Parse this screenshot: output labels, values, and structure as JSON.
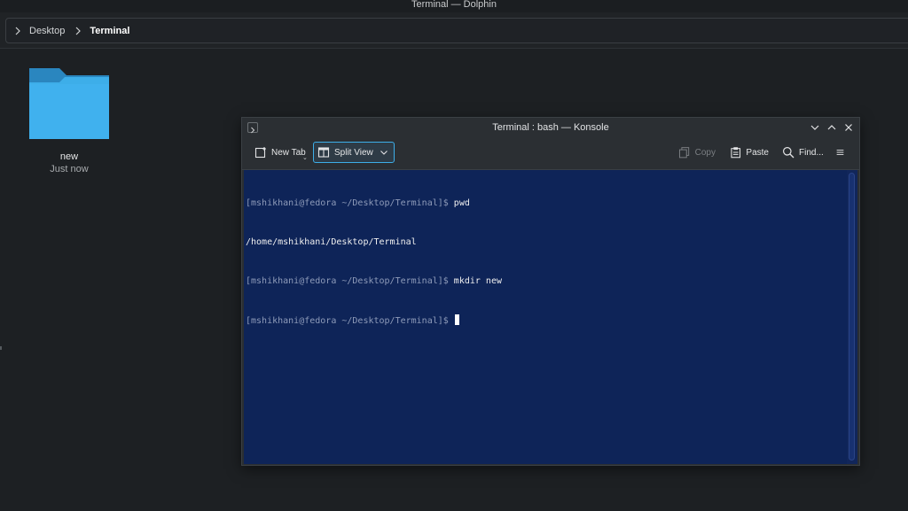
{
  "dolphin": {
    "window_title": "Terminal — Dolphin",
    "breadcrumb": [
      "Desktop",
      "Terminal"
    ],
    "items": [
      {
        "name": "new",
        "date": "Just now",
        "icon": "folder-icon"
      }
    ]
  },
  "konsole": {
    "window_title": "Terminal : bash — Konsole",
    "toolbar": {
      "new_tab": "New Tab",
      "split_view": "Split View",
      "copy": "Copy",
      "paste": "Paste",
      "find": "Find..."
    },
    "terminal_lines": [
      {
        "prompt": "[mshikhani@fedora ~/Desktop/Terminal]$",
        "command": " pwd"
      },
      {
        "output": "/home/mshikhani/Desktop/Terminal"
      },
      {
        "prompt": "[mshikhani@fedora ~/Desktop/Terminal]$",
        "command": " mkdir new"
      },
      {
        "prompt": "[mshikhani@fedora ~/Desktop/Terminal]$",
        "command": " "
      }
    ]
  },
  "colors": {
    "accent": "#3daee9",
    "terminal_bg": "#0e2458",
    "folder": "#3daee9"
  }
}
